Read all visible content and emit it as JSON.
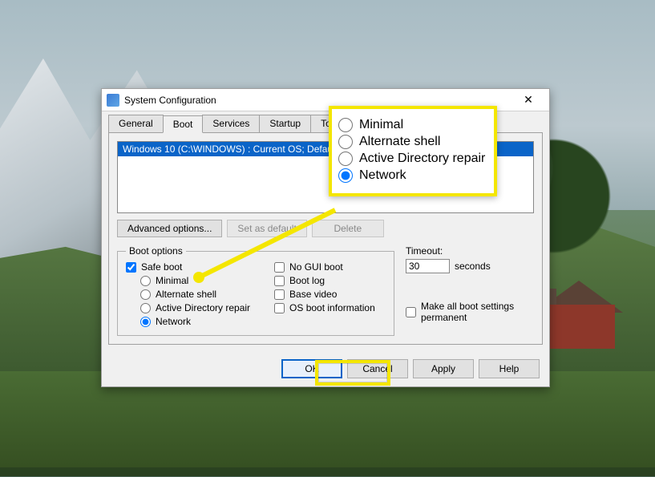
{
  "dialog": {
    "title": "System Configuration",
    "tabs": [
      "General",
      "Boot",
      "Services",
      "Startup",
      "Tools"
    ],
    "active_tab": 1,
    "os_entry": "Windows 10 (C:\\WINDOWS) : Current OS; Default OS",
    "buttons": {
      "advanced": "Advanced options...",
      "set_default": "Set as default",
      "delete": "Delete"
    },
    "boot_options": {
      "legend": "Boot options",
      "safe_boot": "Safe boot",
      "safe_boot_checked": true,
      "modes": [
        "Minimal",
        "Alternate shell",
        "Active Directory repair",
        "Network"
      ],
      "selected_mode": "Network",
      "checks": {
        "no_gui": "No GUI boot",
        "boot_log": "Boot log",
        "base_video": "Base video",
        "os_info": "OS boot information"
      }
    },
    "timeout": {
      "label": "Timeout:",
      "value": "30",
      "unit": "seconds",
      "permanent": "Make all boot settings permanent"
    },
    "footer": {
      "ok": "OK",
      "cancel": "Cancel",
      "apply": "Apply",
      "help": "Help"
    }
  },
  "callout": {
    "options": [
      "Minimal",
      "Alternate shell",
      "Active Directory repair",
      "Network"
    ],
    "selected": "Network"
  }
}
